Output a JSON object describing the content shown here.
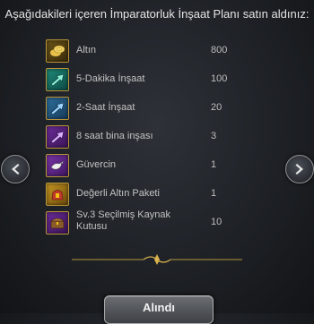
{
  "header": {
    "text": "Aşağıdakileri içeren İmparatorluk İnşaat Planı satın aldınız:"
  },
  "items": [
    {
      "name": "Altın",
      "qty": "800",
      "icon": "gold-coins-icon"
    },
    {
      "name": "5-Dakika İnşaat",
      "qty": "100",
      "icon": "speedup-arrow-icon"
    },
    {
      "name": "2-Saat İnşaat",
      "qty": "20",
      "icon": "speedup-arrow-icon"
    },
    {
      "name": "8 saat bina inşası",
      "qty": "3",
      "icon": "speedup-arrow-icon"
    },
    {
      "name": "Güvercin",
      "qty": "1",
      "icon": "pigeon-icon"
    },
    {
      "name": "Değerli Altın Paketi",
      "qty": "1",
      "icon": "gold-pack-icon"
    },
    {
      "name": "Sv.3 Seçilmiş Kaynak Kutusu",
      "qty": "10",
      "icon": "resource-chest-icon"
    }
  ],
  "button": {
    "label": "Alındı"
  },
  "colors": {
    "frame_gold": "#b8953a",
    "background": "#1e2126"
  }
}
